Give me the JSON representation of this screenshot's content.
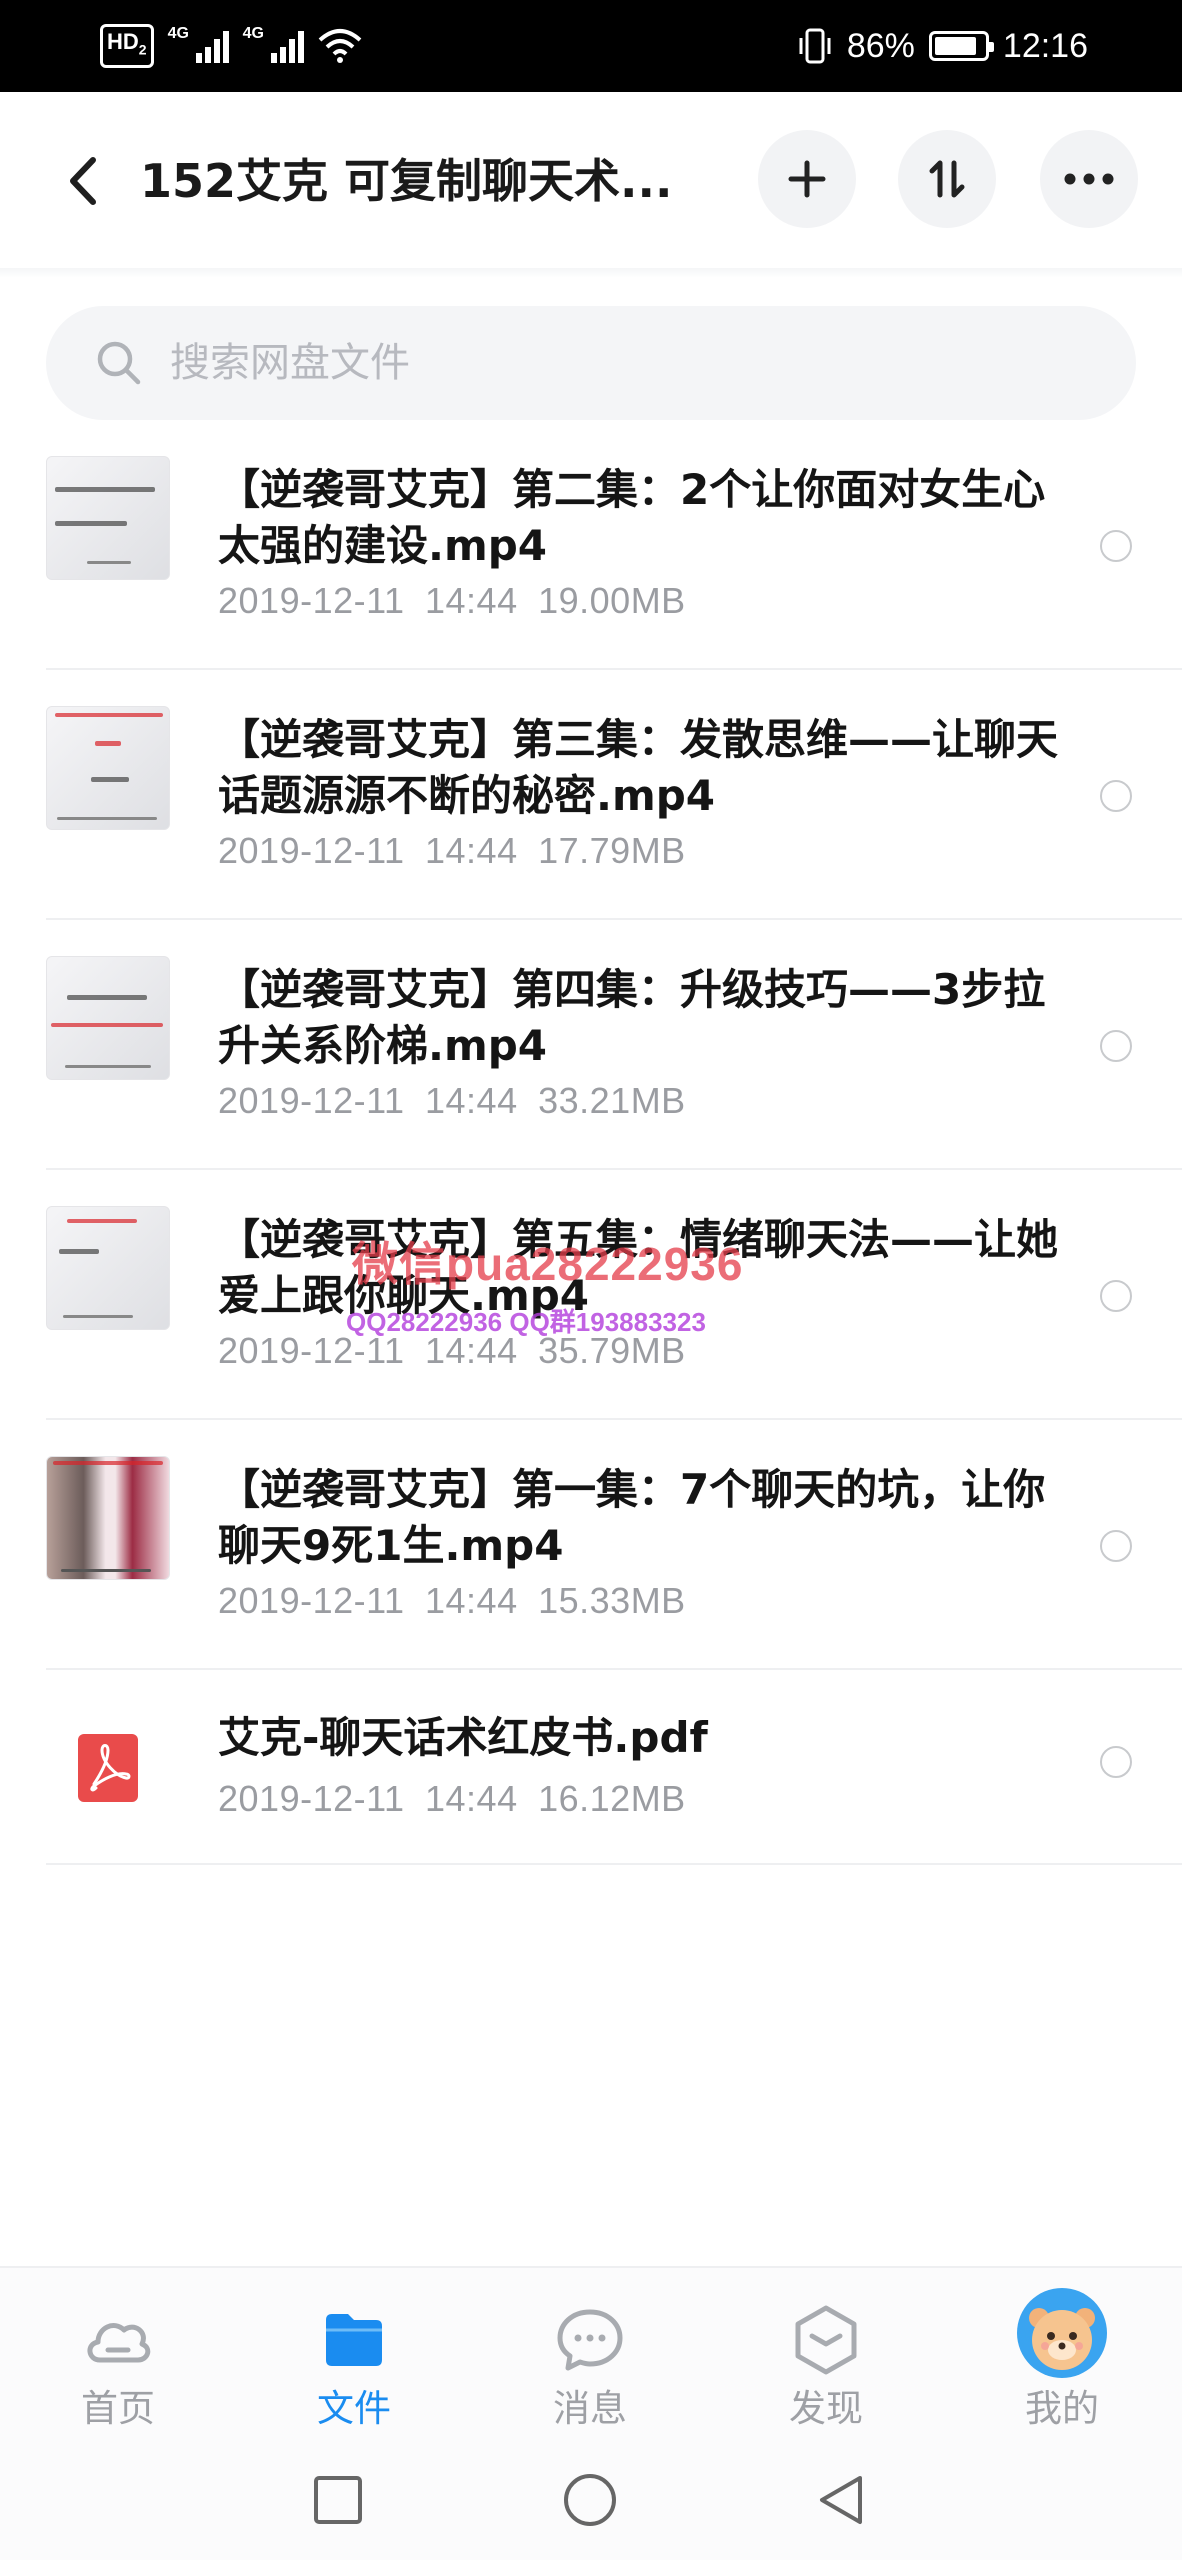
{
  "status_bar": {
    "hd": "HD",
    "hd_sub": "2",
    "signal1_label": "4G",
    "signal2_label": "4G",
    "battery": "86%",
    "battery_level": 0.86,
    "time": "12:16"
  },
  "header": {
    "title": "152艾克 可复制聊天术...",
    "icons": [
      "back-icon",
      "plus-icon",
      "sort-icon",
      "more-icon"
    ]
  },
  "search": {
    "placeholder": "搜索网盘文件"
  },
  "files": [
    {
      "name": "【逆袭哥艾克】第二集：2个让你面对女生心太强的建设.mp4",
      "date": "2019-12-11",
      "time": "14:44",
      "size": "19.00MB",
      "thumb": "video-thumb"
    },
    {
      "name": "【逆袭哥艾克】第三集：发散思维——让聊天话题源源不断的秘密.mp4",
      "date": "2019-12-11",
      "time": "14:44",
      "size": "17.79MB",
      "thumb": "video-thumb"
    },
    {
      "name": "【逆袭哥艾克】第四集：升级技巧——3步拉升关系阶梯.mp4",
      "date": "2019-12-11",
      "time": "14:44",
      "size": "33.21MB",
      "thumb": "video-thumb"
    },
    {
      "name": "【逆袭哥艾克】第五集：情绪聊天法——让她爱上跟你聊天.mp4",
      "date": "2019-12-11",
      "time": "14:44",
      "size": "35.79MB",
      "thumb": "video-thumb"
    },
    {
      "name": "【逆袭哥艾克】第一集：7个聊天的坑，让你聊天9死1生.mp4",
      "date": "2019-12-11",
      "time": "14:44",
      "size": "15.33MB",
      "thumb": "photo-thumb"
    },
    {
      "name": "艾克-聊天话术红皮书.pdf",
      "date": "2019-12-11",
      "time": "14:44",
      "size": "16.12MB",
      "thumb": "pdf-icon"
    }
  ],
  "watermark": {
    "line1": "微信pua28222936",
    "line2": "QQ28222936 QQ群193883323"
  },
  "bottom_nav": [
    {
      "label": "首页",
      "icon": "cloud-icon",
      "active": false
    },
    {
      "label": "文件",
      "icon": "folder-icon",
      "active": true
    },
    {
      "label": "消息",
      "icon": "chat-icon",
      "active": false
    },
    {
      "label": "发现",
      "icon": "discover-icon",
      "active": false
    },
    {
      "label": "我的",
      "icon": "avatar",
      "active": false
    }
  ],
  "colors": {
    "accent": "#1a8cf0",
    "pdf": "#e94b4b",
    "meta_text": "#9a9ca1",
    "watermark_red": "#e43c4a",
    "watermark_purple": "#b23cdc"
  }
}
